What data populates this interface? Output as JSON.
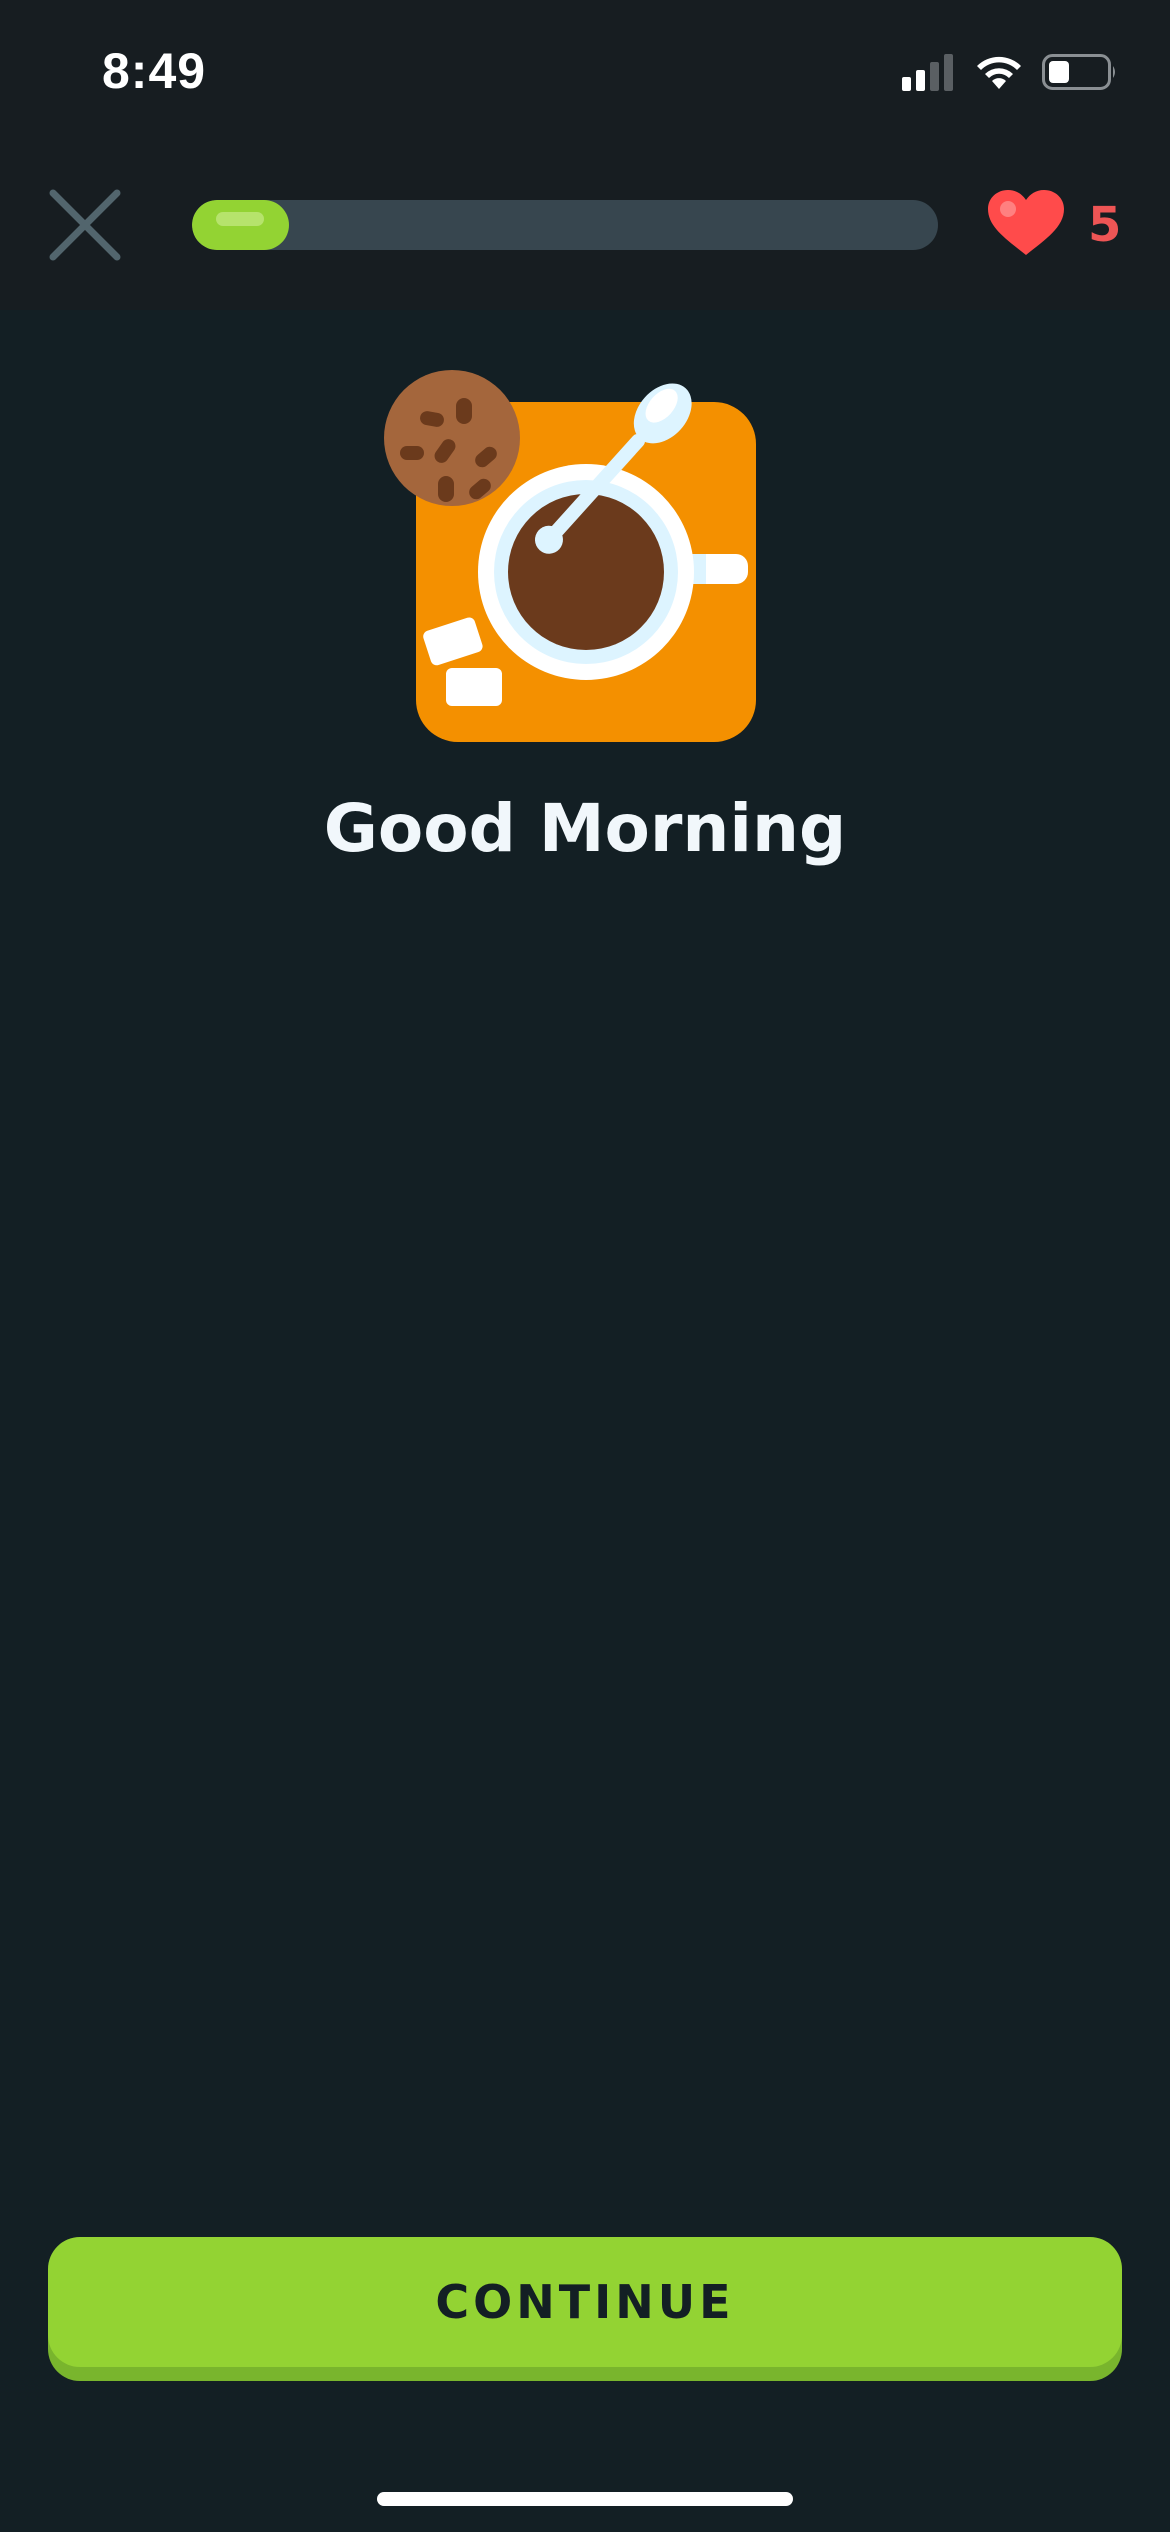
{
  "status_bar": {
    "time": "8:49",
    "icons": [
      "cellular-signal-icon",
      "wifi-icon",
      "battery-icon"
    ]
  },
  "header": {
    "close_icon": "close-icon",
    "progress": 0.13,
    "hearts_icon": "heart-icon",
    "hearts_count": "5"
  },
  "prompt": {
    "illustration": "coffee-cup-illustration",
    "title": "Good Morning"
  },
  "footer": {
    "continue_label": "CONTINUE"
  },
  "colors": {
    "background": "#131f24",
    "accent_green": "#93d333",
    "heart_red": "#ff4b4b",
    "illustration_orange": "#f49000"
  }
}
